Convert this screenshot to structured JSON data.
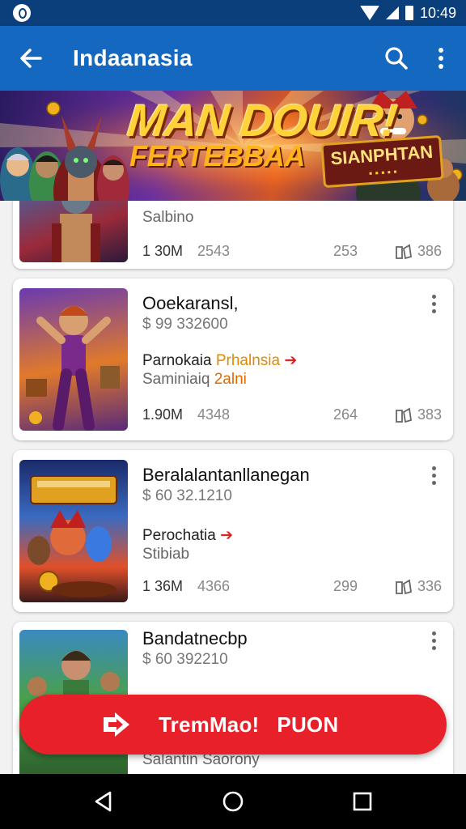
{
  "status_bar": {
    "time": "10:49"
  },
  "app_bar": {
    "title": "Indaanasia"
  },
  "banner": {
    "headline": "MAN DOUIR!",
    "subline": "FERTEBBAA",
    "badge_title": "SIANPHTAN",
    "badge_sub": "▪ ▪ ▪ ▪ ▪"
  },
  "cards": [
    {
      "subtitle": "Salbino",
      "stats": {
        "a": "1 30M",
        "b": "2543",
        "c": "253",
        "d": "386"
      }
    },
    {
      "title": "Ooekaransl,",
      "price": "$ 99 332600",
      "line_prefix": "Parnokaia",
      "line_accent": "Prhalnsia",
      "sub_prefix": "Saminiaiq",
      "sub_accent": "2alni",
      "stats": {
        "a": "1.90M",
        "b": "4348",
        "c": "264",
        "d": "383"
      }
    },
    {
      "title": "Beralalantanllanegan",
      "price": "$ 60 32.1210",
      "line_prefix": "Perochatia",
      "sub_prefix": "Stibiab",
      "stats": {
        "a": "1 36M",
        "b": "4366",
        "c": "299",
        "d": "336"
      }
    },
    {
      "title": "Bandatnecbp",
      "price": "$ 60 392210",
      "sub_prefix": "Salantin Saorony"
    }
  ],
  "fab": {
    "label": "TremMao!",
    "label2": "PUON"
  },
  "colors": {
    "primary": "#1468c0",
    "status_bar": "#0b3f7c",
    "fab": "#e8202a",
    "accent": "#e08a00"
  }
}
